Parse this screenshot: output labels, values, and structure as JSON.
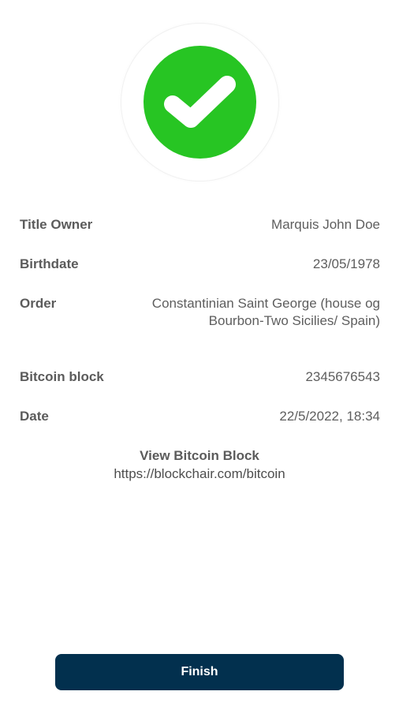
{
  "status": {
    "icon": "check-icon",
    "badge_color": "#27c523"
  },
  "details": [
    {
      "label": "Title Owner",
      "value": "Marquis John Doe"
    },
    {
      "label": "Birthdate",
      "value": "23/05/1978"
    },
    {
      "label": "Order",
      "value": "Constantinian Saint George (house og Bourbon-Two Sicilies/ Spain)"
    },
    {
      "label": "Bitcoin block",
      "value": "2345676543"
    },
    {
      "label": "Date",
      "value": "22/5/2022, 18:34"
    }
  ],
  "bitcoin_link": {
    "title": "View Bitcoin Block",
    "url": "https://blockchair.com/bitcoin"
  },
  "actions": {
    "finish_label": "Finish",
    "button_color": "#02304e"
  }
}
